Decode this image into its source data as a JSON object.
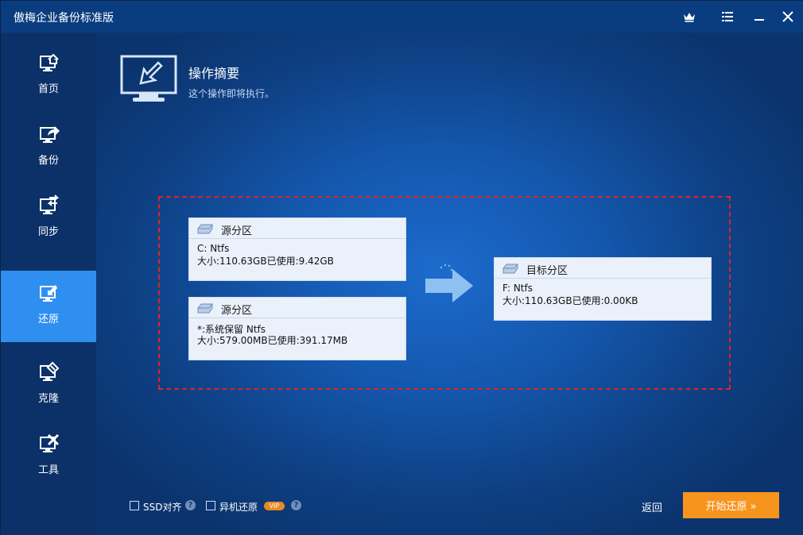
{
  "app": {
    "title": "傲梅企业备份标准版"
  },
  "titlebar": {
    "icons": [
      "crown-icon",
      "menu-icon",
      "minimize-icon",
      "close-icon"
    ]
  },
  "sidebar": {
    "items": [
      {
        "label": "首页",
        "icon": "home-monitor-icon",
        "active": false
      },
      {
        "label": "备份",
        "icon": "backup-monitor-icon",
        "active": false
      },
      {
        "label": "同步",
        "icon": "sync-monitor-icon",
        "active": false
      },
      {
        "label": "还原",
        "icon": "restore-monitor-icon",
        "active": true
      },
      {
        "label": "克隆",
        "icon": "clone-monitor-icon",
        "active": false
      },
      {
        "label": "工具",
        "icon": "tools-monitor-icon",
        "active": false
      }
    ]
  },
  "main": {
    "title": "操作摘要",
    "subtitle": "这个操作即将执行。",
    "sources": [
      {
        "title": "源分区",
        "line1": "C: Ntfs",
        "line2": "大小:110.63GB已使用:9.42GB"
      },
      {
        "title": "源分区",
        "line1": "*:系统保留 Ntfs",
        "line2": "大小:579.00MB已使用:391.17MB"
      }
    ],
    "target": {
      "title": "目标分区",
      "line1": "F: Ntfs",
      "line2": "大小:110.63GB已使用:0.00KB"
    }
  },
  "footer": {
    "ssd_label": "SSD对齐",
    "remote_label": "异机还原",
    "vip_badge": "VIP",
    "help_glyph": "?",
    "back_label": "返回",
    "start_label": "开始还原 »"
  },
  "colors": {
    "accent": "#2e8ff0",
    "start_button": "#f7941d",
    "dashed_frame": "#e02323"
  }
}
